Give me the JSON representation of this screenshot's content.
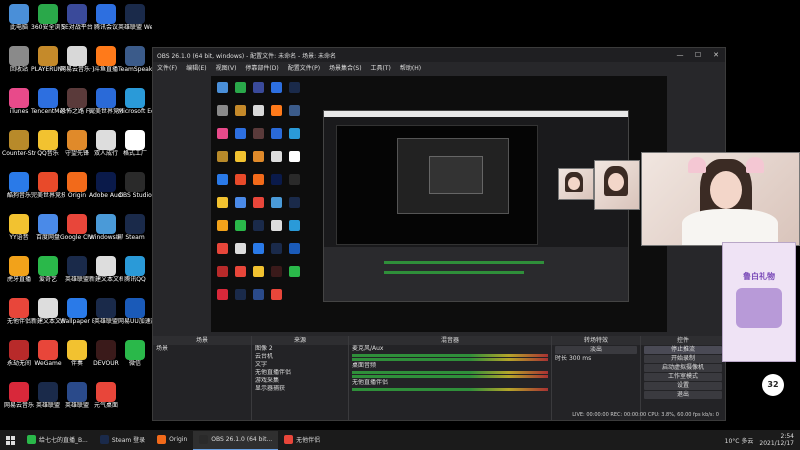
{
  "desktop": {
    "icons": [
      {
        "label": "此电脑",
        "color": "#4a8fd8"
      },
      {
        "label": "360安全浏览器",
        "color": "#2aa84a"
      },
      {
        "label": "5E对战平台",
        "color": "#3a4a9a"
      },
      {
        "label": "腾讯会议",
        "color": "#2d6fe0"
      },
      {
        "label": "英雄联盟 WeGame版",
        "color": "#1a2a4a"
      },
      {
        "label": "回收站",
        "color": "#8a8a8a"
      },
      {
        "label": "PLAYERUNKNOWN'S BATTLEGROUNDS",
        "color": "#c58a2a"
      },
      {
        "label": "网易云音乐·直播",
        "color": "#d8d8d8"
      },
      {
        "label": "斗鱼直播",
        "color": "#ff7a1a"
      },
      {
        "label": "TeamSpeak 3",
        "color": "#3b5b8a"
      },
      {
        "label": "iTunes",
        "color": "#e84a8a"
      },
      {
        "label": "TencentMeeting",
        "color": "#2d6fe0"
      },
      {
        "label": "恐怖之路 Fear Sur...",
        "color": "#5a3a3a"
      },
      {
        "label": "完美世界竞技平台",
        "color": "#2a6ad8"
      },
      {
        "label": "Microsoft Edge",
        "color": "#2a9ad8"
      },
      {
        "label": "Counter-Strike Global Off...",
        "color": "#b88a2a"
      },
      {
        "label": "QQ音乐",
        "color": "#f2c230"
      },
      {
        "label": "守望先锋",
        "color": "#e08a2a"
      },
      {
        "label": "双人成行",
        "color": "#dddddd"
      },
      {
        "label": "格式工厂",
        "color": "#ffffff"
      },
      {
        "label": "酷狗音乐",
        "color": "#2a7ae8"
      },
      {
        "label": "完美世界竞技平台",
        "color": "#e84a2a"
      },
      {
        "label": "Origin",
        "color": "#f26a1a"
      },
      {
        "label": "Adobe Audition",
        "color": "#0a1a4a"
      },
      {
        "label": "OBS Studio",
        "color": "#2a2a2a"
      },
      {
        "label": "YY语音",
        "color": "#f2c230"
      },
      {
        "label": "百度网盘",
        "color": "#4a8ae8"
      },
      {
        "label": "Google Chrome",
        "color": "#e8463a"
      },
      {
        "label": "Windows编辑器",
        "color": "#4a9ad8"
      },
      {
        "label": "Steam",
        "color": "#1a2a4a"
      },
      {
        "label": "虎牙直播",
        "color": "#f2a21a"
      },
      {
        "label": "爱奇艺",
        "color": "#2ab84a"
      },
      {
        "label": "英雄联盟",
        "color": "#1a2a4a"
      },
      {
        "label": "新建文本文档",
        "color": "#dddddd"
      },
      {
        "label": "腾讯QQ",
        "color": "#2a9ad8"
      },
      {
        "label": "无他伴侣",
        "color": "#e8463a"
      },
      {
        "label": "新建文本文档 (2)",
        "color": "#dddddd"
      },
      {
        "label": "Wallpaper Engine:...",
        "color": "#2a7ae8"
      },
      {
        "label": "英雄联盟",
        "color": "#1a2a4a"
      },
      {
        "label": "网易UU加速器",
        "color": "#1a5ab8"
      },
      {
        "label": "永劫无间",
        "color": "#b82a2a"
      },
      {
        "label": "WeGame",
        "color": "#e8463a"
      },
      {
        "label": "伴奏",
        "color": "#f2c230"
      },
      {
        "label": "DEVOUR",
        "color": "#3a1a1a"
      },
      {
        "label": "微信",
        "color": "#2ab84a"
      },
      {
        "label": "网易云音乐",
        "color": "#d8283a"
      },
      {
        "label": "英雄联盟",
        "color": "#1a2a4a"
      },
      {
        "label": "英雄联盟",
        "color": "#2a4a8a"
      },
      {
        "label": "元气桌面",
        "color": "#e8463a"
      }
    ]
  },
  "obs": {
    "title": "OBS 26.1.0 (64 bit, windows) - 配置文件: 未命名 - 场景: 未命名",
    "menu": [
      "文件(F)",
      "编辑(E)",
      "视图(V)",
      "停靠部件(D)",
      "配置文件(P)",
      "场景集合(S)",
      "工具(T)",
      "帮助(H)"
    ],
    "docks": {
      "scenes": {
        "title": "场景",
        "items": [
          "场景"
        ]
      },
      "sources": {
        "title": "来源",
        "items": [
          "图像 2",
          "云台机",
          "文字",
          "无他直播伴侣",
          "游戏采集",
          "显示器捕获"
        ]
      },
      "mixer": {
        "title": "混音器",
        "tracks": [
          {
            "name": "麦克风/Aux",
            "db": "0.0 dB"
          },
          {
            "name": "桌面音频",
            "db": "0.0 dB"
          },
          {
            "name": "无他直播伴侣",
            "db": "0.0 dB"
          }
        ]
      },
      "transitions": {
        "title": "转场特效",
        "type": "淡出",
        "duration_label": "时长",
        "duration": "300 ms"
      },
      "controls": {
        "title": "控件",
        "buttons": [
          "停止推流",
          "开始录制",
          "启动虚拟摄像机",
          "工作室模式",
          "设置",
          "退出"
        ]
      }
    },
    "status": "LIVE: 00:00:00  REC: 00:00:00  CPU: 3.8%, 60.00 fps  kb/s: 0"
  },
  "gift_panel": {
    "title": "鲁白礼物",
    "count": "32"
  },
  "taskbar": {
    "items": [
      {
        "label": "给七七的直播_B...",
        "color": "#2ab84a"
      },
      {
        "label": "Steam 登录",
        "color": "#1a2a4a"
      },
      {
        "label": "Origin",
        "color": "#f26a1a"
      },
      {
        "label": "OBS 26.1.0 (64 bit...",
        "color": "#2a2a2a"
      },
      {
        "label": "无他伴侣",
        "color": "#e8463a"
      }
    ],
    "weather": "10°C 多云",
    "time": "2:54",
    "date": "2021/12/17"
  }
}
